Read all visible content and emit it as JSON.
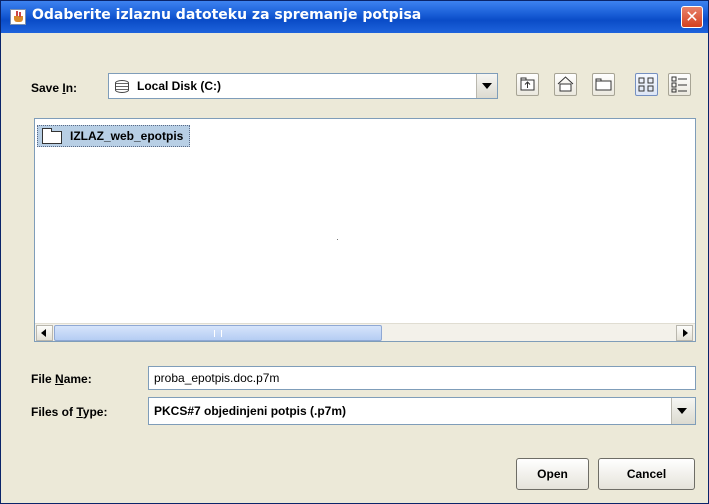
{
  "window": {
    "title": "Odaberite izlaznu datoteku za spremanje potpisa",
    "close_glyph": "✕"
  },
  "save_in": {
    "label_pre": "Save ",
    "label_mnemonic": "I",
    "label_post": "n:",
    "value": "Local Disk (C:)",
    "icon": "disk-icon"
  },
  "toolbar": {
    "buttons": [
      {
        "name": "up-one-level-button",
        "icon": "folder-up-icon"
      },
      {
        "name": "home-button",
        "icon": "home-icon"
      },
      {
        "name": "new-folder-button",
        "icon": "new-folder-icon"
      },
      {
        "name": "list-view-button",
        "icon": "list-view-icon",
        "selected": true
      },
      {
        "name": "details-view-button",
        "icon": "details-view-icon"
      }
    ]
  },
  "file_list": {
    "items": [
      {
        "label": "IZLAZ_web_epotpis",
        "type": "folder",
        "selected": true
      }
    ]
  },
  "file_name": {
    "label_pre": "File ",
    "label_mnemonic": "N",
    "label_post": "ame:",
    "value": "proba_epotpis.doc.p7m"
  },
  "file_type": {
    "label_pre": "Files of ",
    "label_mnemonic": "T",
    "label_post": "ype:",
    "value": "PKCS#7 objedinjeni potpis (.p7m)"
  },
  "buttons": {
    "open": "Open",
    "cancel": "Cancel"
  },
  "colors": {
    "titlebar": "#0a4cc7",
    "dialog_bg": "#ece9d8",
    "selection": "#b8cfe5"
  }
}
